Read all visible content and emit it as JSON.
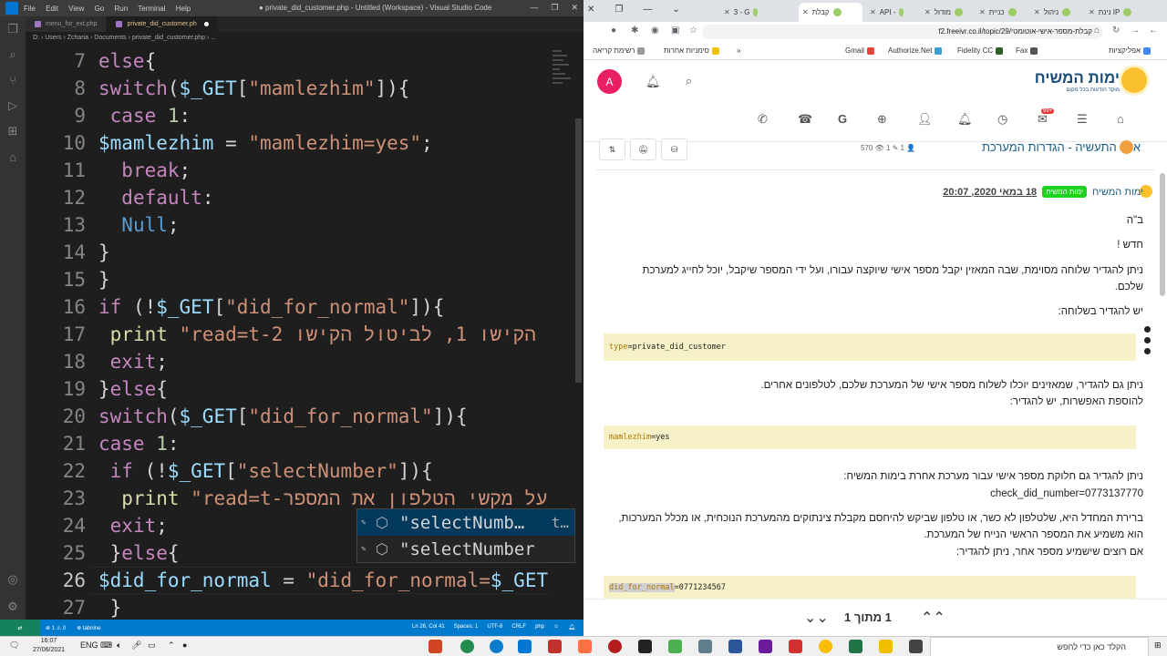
{
  "vscode": {
    "menu": [
      "File",
      "Edit",
      "View",
      "Go",
      "Run",
      "Terminal",
      "Help"
    ],
    "window_title": "● private_did_customer.php - Untitled (Workspace) - Visual Studio Code",
    "tabs": [
      {
        "label": "menu_for_ext.php",
        "active": false
      },
      {
        "label": "private_did_customer.ph",
        "active": true
      }
    ],
    "breadcrumb": "D: › Users › Zcharia › Documents › private_did_customer.php › ...",
    "code_lines": [
      {
        "num": "7",
        "html_key": "l7"
      },
      {
        "num": "8",
        "html_key": "l8"
      }
    ],
    "line_numbers": [
      "7",
      "8",
      "9",
      "10",
      "11",
      "12",
      "13",
      "14",
      "15",
      "16",
      "17",
      "18",
      "19",
      "20",
      "21",
      "22",
      "23",
      "24",
      "25",
      "26",
      "27"
    ],
    "suggestions": [
      {
        "label": "\"selectNumb…",
        "hint": "t…",
        "selected": true
      },
      {
        "label": "\"selectNumber",
        "hint": "",
        "selected": false
      }
    ],
    "status": {
      "errors": "⊗ 1 ⚠ 0",
      "tabnine": "⊗ tabnine",
      "position": "Ln 26, Col 41",
      "spaces": "Spaces: 1",
      "encoding": "UTF-8",
      "eol": "CRLF",
      "language": "php"
    }
  },
  "chrome": {
    "tabs": [
      "נינת IP",
      "ניהול",
      "כניית",
      "מודול",
      "API -",
      "קבלת",
      "3 - G"
    ],
    "active_tab": "קבלת",
    "url": "f2.freeivr.co.il/topic/29/קבלת-מספר-אישי-אוטומטי",
    "bookmarks": [
      "אפליקציות",
      "Fax",
      "Fidelity CC",
      "Authorize.Net",
      "Gmail",
      "סימניות אחרות",
      "רשימת קריאה"
    ]
  },
  "site": {
    "avatar_letter": "A",
    "logo_text": "ימות המשיח",
    "logo_sub": "מוקד הודעות בכל מקום",
    "notif_badge": "99+",
    "topic_title": "אזור התעשיה - הגדרות המערכת",
    "topic_stats": "570 👁  1 ✎  1 👤",
    "author": "ימות המשיח",
    "group_badge": "ימות המשיח",
    "post_date": "18 במאי 2020, 20:07",
    "p1": "ב\"ה",
    "p2": "חדש !",
    "p3a": "ניתן להגדיר שלוחה מסוימת, שבה המאזין יקבל מספר אישי שיוקצה עבורו, ועל ידי המספר שיקבל, יוכל לחייג למערכת",
    "p3b": "שלכם.",
    "p4": "יש להגדיר בשלוחה:",
    "code1_key": "type",
    "code1_val": "=private_did_customer",
    "p5a": "ניתן גם להגדיר, שמאזינים יוכלו לשלוח מספר אישי של המערכת שלכם, לטלפונים אחרים.",
    "p5b": "להוספת האפשרות, יש להגדיר:",
    "code2_key": "mamlezhim",
    "code2_val": "=yes",
    "p6a": "ניתן להגדיר גם חלוקת מספר אישי עבור מערכת אחרת בימות המשיח:",
    "p6b": "check_did_number=0773137770",
    "p7a": "ברירת המחדל היא, שלטלפון לא כשר, או טלפון שביקש להיחסם מקבלת צינתוקים מהמערכת הנוכחית, או מכלל המערכות,",
    "p7b": "הוא משמיע את המספר הראשי הנייח של המערכת.",
    "p7c": "אם רוצים שישמיע מספר אחר, ניתן להגדיר:",
    "code3_key": "did_for_normal",
    "code3_val": "=0771234567",
    "pager": "1 מתוך 1"
  },
  "taskbar": {
    "lang": "ENG",
    "time": "16:07",
    "date": "27/06/2021",
    "search_placeholder": "הקלד כאן כדי לחפש"
  },
  "colors": {
    "vscode_bg": "#1e1e1e",
    "vscode_status": "#007acc",
    "string": "#ce9178",
    "keyword": "#c586c0",
    "variable": "#9cdcfe",
    "code_box_bg": "#f6f1c7",
    "group_badge": "#1fd11f"
  }
}
